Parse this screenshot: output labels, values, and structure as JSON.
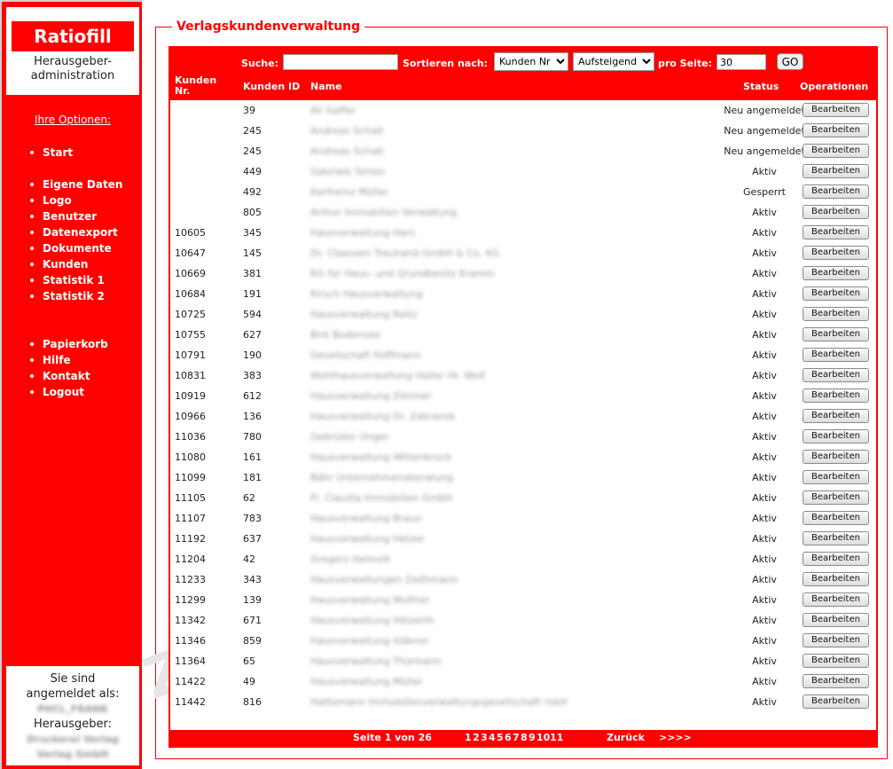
{
  "brand": {
    "name": "Ratiofill",
    "subtitle_line1": "Herausgeber-",
    "subtitle_line2": "administration"
  },
  "sidebar": {
    "options_label": "Ihre Optionen:",
    "group1": [
      {
        "label": "Start"
      }
    ],
    "group2": [
      {
        "label": "Eigene Daten"
      },
      {
        "label": "Logo"
      },
      {
        "label": "Benutzer"
      },
      {
        "label": "Datenexport"
      },
      {
        "label": "Dokumente"
      },
      {
        "label": "Kunden"
      },
      {
        "label": "Statistik 1"
      },
      {
        "label": "Statistik 2"
      }
    ],
    "group3": [
      {
        "label": "Papierkorb"
      },
      {
        "label": "Hilfe"
      },
      {
        "label": "Kontakt"
      },
      {
        "label": "Logout"
      }
    ],
    "login": {
      "line1": "Sie sind",
      "line2": "angemeldet als:",
      "user_blurred": "PHCL_FRANK",
      "publisher_label": "Herausgeber:",
      "publisher_blurred_1": "Druckerei Verlag",
      "publisher_blurred_2": "Verlag GmbH"
    }
  },
  "main": {
    "legend": "Verlagskundenverwaltung",
    "search_label": "Suche:",
    "search_value": "",
    "sort_label": "Sortieren nach:",
    "sort_value": "Kunden Nr",
    "order_value": "Aufsteigend",
    "per_page_label": "pro Seite:",
    "per_page_value": "30",
    "go_label": "GO",
    "columns": {
      "nr_line1": "Kunden",
      "nr_line2": "Nr.",
      "id": "Kunden ID",
      "name": "Name",
      "status": "Status",
      "ops": "Operationen"
    },
    "edit_label": "Bearbeiten",
    "rows": [
      {
        "nr": "",
        "id": "39",
        "name": "Ali Gaffer",
        "status": "Neu angemeldet"
      },
      {
        "nr": "",
        "id": "245",
        "name": "Andreas Schalt",
        "status": "Neu angemeldet"
      },
      {
        "nr": "",
        "id": "245",
        "name": "Andreas Schalt",
        "status": "Neu angemeldet"
      },
      {
        "nr": "",
        "id": "449",
        "name": "Gabriele Simon",
        "status": "Aktiv"
      },
      {
        "nr": "",
        "id": "492",
        "name": "Karlheinz Müller",
        "status": "Gesperrt"
      },
      {
        "nr": "",
        "id": "805",
        "name": "Arthur Immobilien Verwaltung",
        "status": "Aktiv"
      },
      {
        "nr": "10605",
        "id": "345",
        "name": "Hausverwaltung Hars",
        "status": "Aktiv"
      },
      {
        "nr": "10647",
        "id": "145",
        "name": "Dr. Claessen Treuhand GmbH & Co. KG",
        "status": "Aktiv"
      },
      {
        "nr": "10669",
        "id": "381",
        "name": "KG für Haus- und Grundbesitz Kramm",
        "status": "Aktiv"
      },
      {
        "nr": "10684",
        "id": "191",
        "name": "Kirsch Hausverwaltung",
        "status": "Aktiv"
      },
      {
        "nr": "10725",
        "id": "594",
        "name": "Hausverwaltung Reitz",
        "status": "Aktiv"
      },
      {
        "nr": "10755",
        "id": "627",
        "name": "Birk Bodensee",
        "status": "Aktiv"
      },
      {
        "nr": "10791",
        "id": "190",
        "name": "Gesellschaft Hoffmann",
        "status": "Aktiv"
      },
      {
        "nr": "10831",
        "id": "383",
        "name": "Wohlhausverwaltung Haller Hr. Wolf",
        "status": "Aktiv"
      },
      {
        "nr": "10919",
        "id": "612",
        "name": "Hausverwaltung Zimmer",
        "status": "Aktiv"
      },
      {
        "nr": "10966",
        "id": "136",
        "name": "Hausverwaltung Dr. Zabransk",
        "status": "Aktiv"
      },
      {
        "nr": "11036",
        "id": "780",
        "name": "Gebrüder Unger",
        "status": "Aktiv"
      },
      {
        "nr": "11080",
        "id": "161",
        "name": "Hausverwaltung Wittenbrock",
        "status": "Aktiv"
      },
      {
        "nr": "11099",
        "id": "181",
        "name": "Bähr Unternehmensberatung",
        "status": "Aktiv"
      },
      {
        "nr": "11105",
        "id": "62",
        "name": "Fr. Claudia Immobilien GmbH",
        "status": "Aktiv"
      },
      {
        "nr": "11107",
        "id": "783",
        "name": "Hausverwaltung Braun",
        "status": "Aktiv"
      },
      {
        "nr": "11192",
        "id": "637",
        "name": "Hausverwaltung Hetzel",
        "status": "Aktiv"
      },
      {
        "nr": "11204",
        "id": "42",
        "name": "Gregorz Helmolt",
        "status": "Aktiv"
      },
      {
        "nr": "11233",
        "id": "343",
        "name": "Hausverwaltungen Zeithmann",
        "status": "Aktiv"
      },
      {
        "nr": "11299",
        "id": "139",
        "name": "Hausverwaltung Molfner",
        "status": "Aktiv"
      },
      {
        "nr": "11342",
        "id": "671",
        "name": "Hausverwaltung Hölzerth",
        "status": "Aktiv"
      },
      {
        "nr": "11346",
        "id": "859",
        "name": "Hausverwaltung Göbner",
        "status": "Aktiv"
      },
      {
        "nr": "11364",
        "id": "65",
        "name": "Hausverwaltung Thiemann",
        "status": "Aktiv"
      },
      {
        "nr": "11422",
        "id": "49",
        "name": "Hausverwaltung Müller",
        "status": "Aktiv"
      },
      {
        "nr": "11442",
        "id": "816",
        "name": "Hattemann Immobilienverwaltungsgesellschaft mbH",
        "status": "Aktiv"
      }
    ],
    "pager": {
      "page_info": "Seite 1 von 26",
      "pages": [
        "1",
        "2",
        "3",
        "4",
        "5",
        "6",
        "7",
        "8",
        "9",
        "10",
        "11"
      ],
      "back": "Zurück",
      "next": ">>>>"
    },
    "watermark": "Z-ITS"
  },
  "colors": {
    "accent": "#ff0000"
  }
}
